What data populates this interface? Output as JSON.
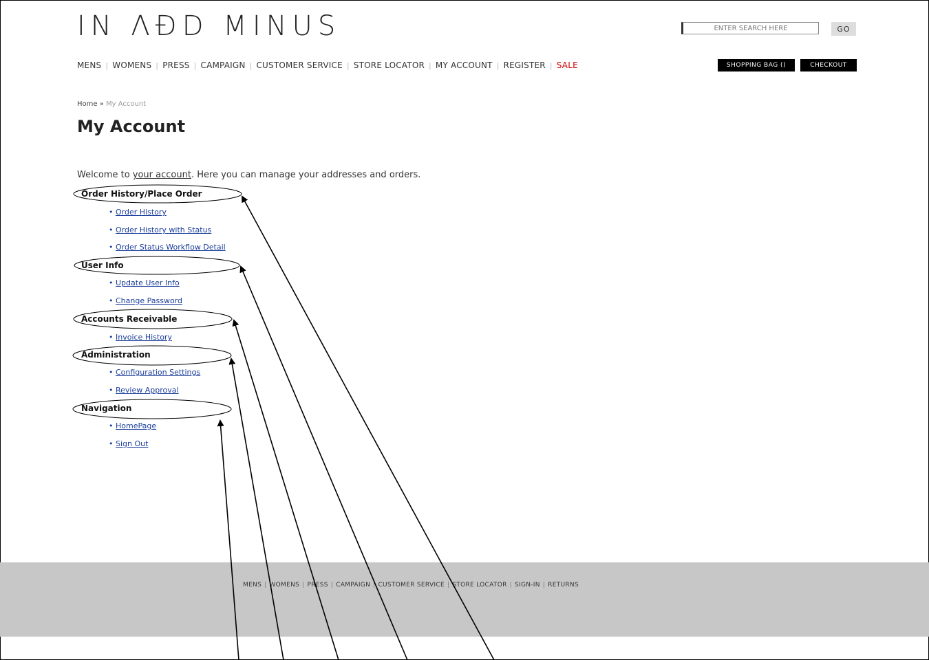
{
  "brand": {
    "logo_text": "IN ΛÐD MINUS"
  },
  "search": {
    "placeholder": "ENTER SEARCH HERE",
    "go_label": "GO"
  },
  "nav": {
    "items": [
      "MENS",
      "WOMENS",
      "PRESS",
      "CAMPAIGN",
      "CUSTOMER SERVICE",
      "STORE LOCATOR",
      "MY ACCOUNT",
      "REGISTER"
    ],
    "sale_label": "SALE",
    "separator": "|"
  },
  "actions": {
    "bag_label": "SHOPPING BAG ()",
    "checkout_label": "CHECKOUT"
  },
  "breadcrumb": {
    "home": "Home",
    "separator": "»",
    "current": "My Account"
  },
  "page": {
    "title": "My Account",
    "welcome_prefix": "Welcome to ",
    "welcome_link": "your account",
    "welcome_suffix": ". Here you can manage your addresses and orders."
  },
  "sections": [
    {
      "title": "Order History/Place Order",
      "links": [
        "Order History",
        "Order History with Status",
        "Order Status Workflow Detail"
      ]
    },
    {
      "title": "User Info",
      "links": [
        "Update User Info",
        "Change Password"
      ]
    },
    {
      "title": "Accounts Receivable",
      "links": [
        "Invoice History"
      ]
    },
    {
      "title": "Administration",
      "links": [
        "Configuration Settings",
        "Review Approval"
      ]
    },
    {
      "title": "Navigation",
      "links": [
        "HomePage",
        "Sign Out"
      ]
    }
  ],
  "footer": {
    "items": [
      "MENS",
      "WOMENS",
      "PRESS",
      "CAMPAIGN",
      "CUSTOMER SERVICE",
      "STORE LOCATOR",
      "SIGN-IN",
      "RETURNS"
    ]
  }
}
